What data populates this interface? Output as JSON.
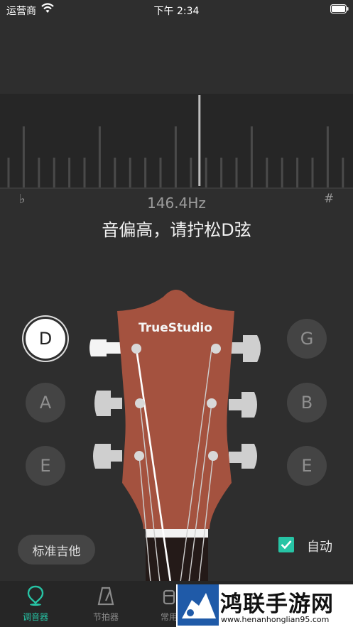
{
  "status_bar": {
    "carrier": "运营商",
    "time": "下午 2:34"
  },
  "tuner": {
    "flat_symbol": "♭",
    "sharp_symbol": "#",
    "frequency": "146.4Hz",
    "hint": "音偏高，请拧松D弦",
    "needle_offset_fraction": 0.565
  },
  "strings_left": [
    {
      "note": "D",
      "active": true
    },
    {
      "note": "A",
      "active": false
    },
    {
      "note": "E",
      "active": false
    }
  ],
  "strings_right": [
    {
      "note": "G",
      "active": false
    },
    {
      "note": "B",
      "active": false
    },
    {
      "note": "E",
      "active": false
    }
  ],
  "headstock": {
    "brand": "TrueStudio",
    "color": "#a4523f"
  },
  "preset_button": "标准吉他",
  "auto": {
    "label": "自动",
    "checked": true,
    "color": "#27c4a5"
  },
  "tabs": [
    {
      "label": "调音器",
      "icon": "tuner-pin-icon",
      "active": true
    },
    {
      "label": "节拍器",
      "icon": "metronome-icon",
      "active": false
    },
    {
      "label": "常用",
      "icon": "chord-icon",
      "active": false
    }
  ],
  "watermark": {
    "title": "鸿联手游网",
    "url": "www.henanhonglian95.com"
  },
  "colors": {
    "accent": "#27c4a5",
    "background": "#2e2e2e"
  }
}
